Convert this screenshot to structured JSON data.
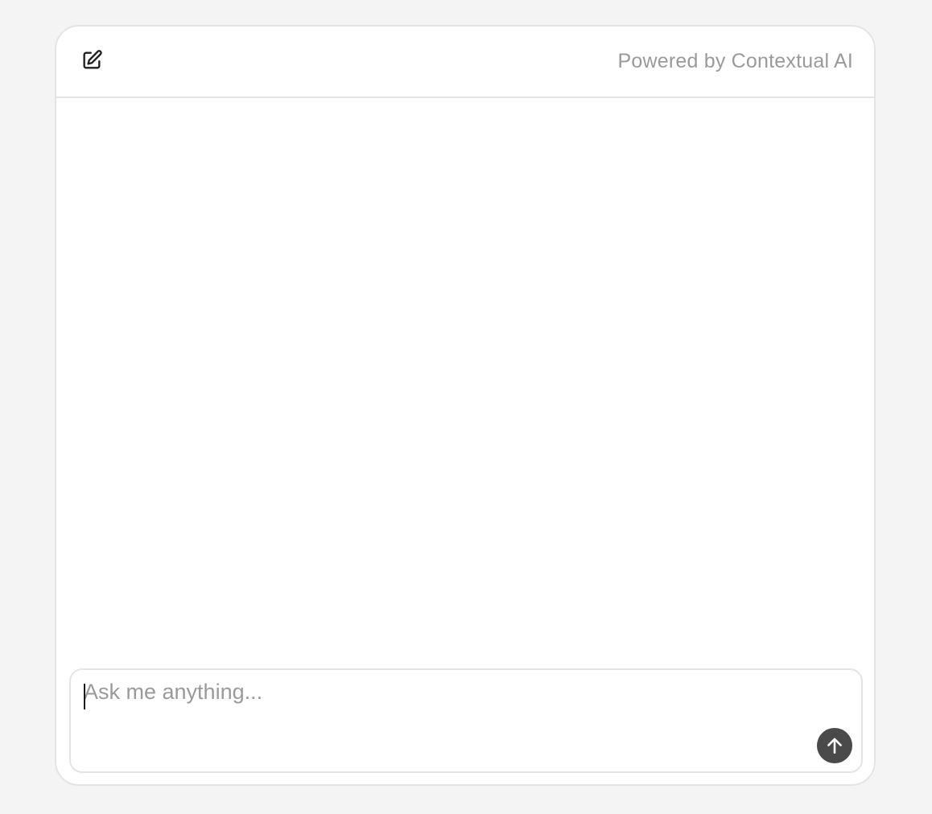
{
  "header": {
    "new_chat_icon": "edit-square-icon",
    "powered_by": "Powered by Contextual AI"
  },
  "composer": {
    "placeholder": "Ask me anything...",
    "value": "",
    "send_icon": "arrow-up-icon"
  },
  "colors": {
    "background": "#f4f4f4",
    "card": "#ffffff",
    "border": "#e4e4e4",
    "muted_text": "#9a9a9a",
    "send_button": "#4a4a4a"
  }
}
